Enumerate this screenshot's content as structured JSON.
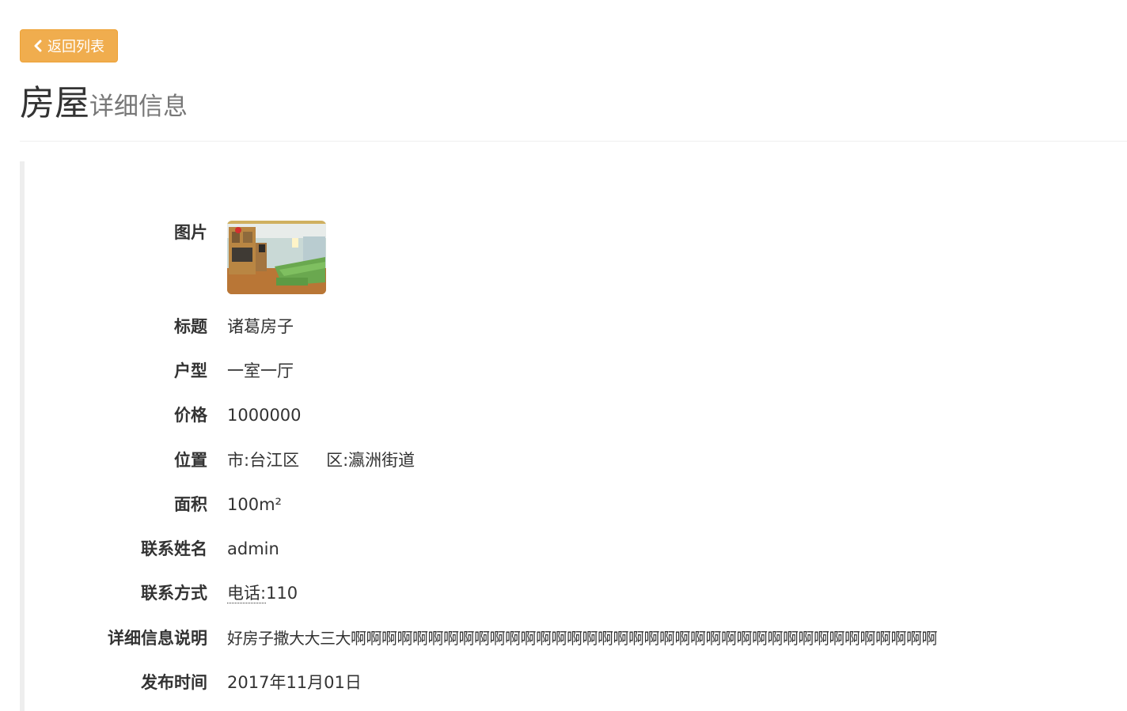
{
  "back_button": {
    "label": "返回列表",
    "icon": "chevron-left-icon",
    "color": "#f0ad4e"
  },
  "header": {
    "title_main": "房屋",
    "title_sub": "详细信息"
  },
  "detail": {
    "photo_label": "图片",
    "fields": [
      {
        "label": "标题",
        "value": "诸葛房子"
      },
      {
        "label": "户型",
        "value": "一室一厅"
      },
      {
        "label": "价格",
        "value": "1000000"
      },
      {
        "label": "位置",
        "city": "市:台江区",
        "district": "区:瀛洲街道"
      },
      {
        "label": "面积",
        "value": "100m²"
      },
      {
        "label": "联系姓名",
        "value": "admin"
      },
      {
        "label": "联系方式",
        "phone_label": "电话:",
        "phone_value": "110"
      },
      {
        "label": "详细信息说明",
        "value": "好房子撒大大三大啊啊啊啊啊啊啊啊啊啊啊啊啊啊啊啊啊啊啊啊啊啊啊啊啊啊啊啊啊啊啊啊啊啊啊啊啊啊"
      },
      {
        "label": "发布时间",
        "value": "2017年11月01日"
      }
    ]
  }
}
